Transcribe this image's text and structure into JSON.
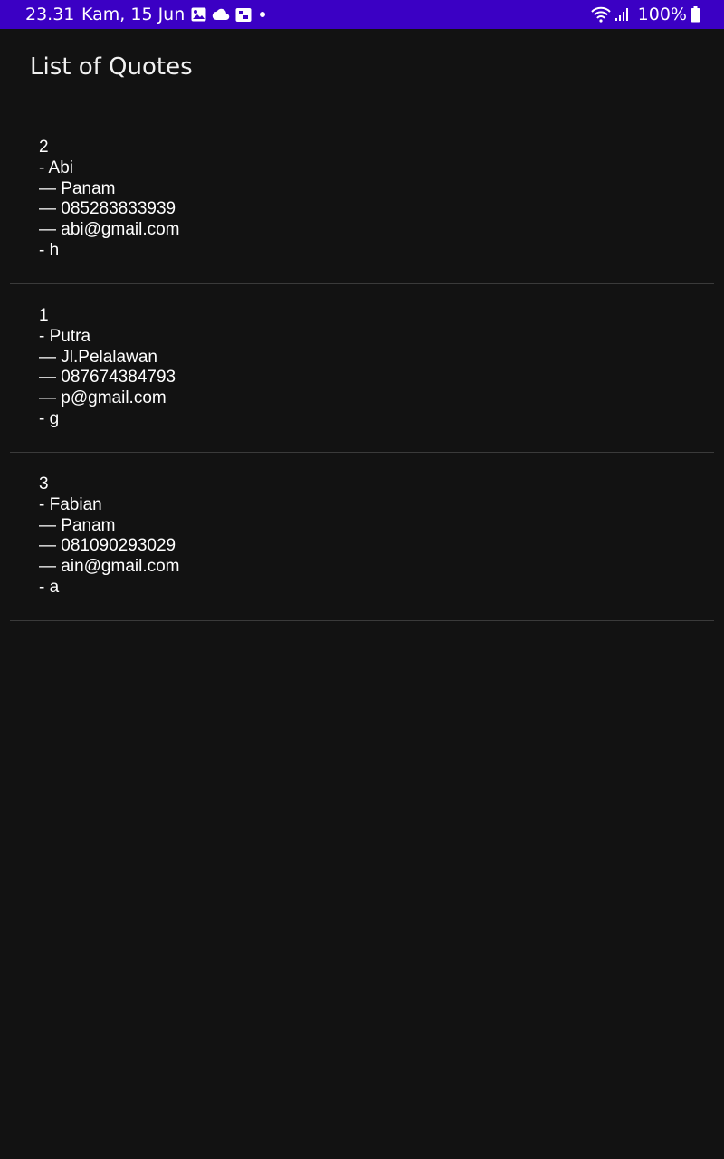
{
  "status_bar": {
    "time": "23.31",
    "date": "Kam, 15 Jun",
    "notification_icons": [
      "gallery-icon",
      "cloud-icon",
      "screenshot-icon",
      "dot-icon"
    ],
    "system_icons": [
      "wifi-icon",
      "signal-icon",
      "battery-icon"
    ],
    "battery": "100%",
    "background_color": "#3b00c4"
  },
  "app_bar": {
    "title": "List of Quotes"
  },
  "quotes": [
    {
      "id": "2",
      "name": "- Abi",
      "address": "— Panam",
      "phone": "— 085283833939",
      "email": "— abi@gmail.com",
      "note": "- h"
    },
    {
      "id": "1",
      "name": "- Putra",
      "address": "— Jl.Pelalawan",
      "phone": "— 087674384793",
      "email": "— p@gmail.com",
      "note": "- g"
    },
    {
      "id": "3",
      "name": "- Fabian",
      "address": "— Panam",
      "phone": "— 081090293029",
      "email": "— ain@gmail.com",
      "note": "- a"
    }
  ],
  "colors": {
    "background": "#121212",
    "divider": "#3a3a3a",
    "text": "#ffffff"
  }
}
